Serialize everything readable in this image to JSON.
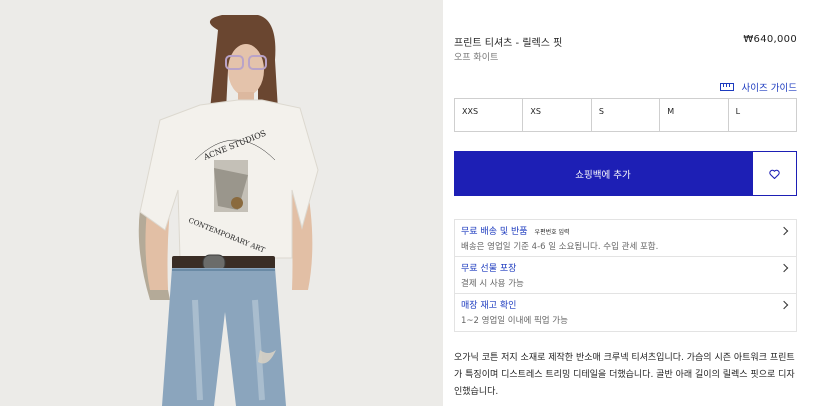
{
  "product": {
    "title": "프린트 티셔츠 - 릴렉스 핏",
    "price": "₩640,000",
    "color": "오프 화이트"
  },
  "size_guide": {
    "label": "사이즈 가이드",
    "icon": "ruler-icon"
  },
  "sizes": [
    "XXS",
    "XS",
    "S",
    "M",
    "L"
  ],
  "cart": {
    "add_label": "쇼핑백에 추가",
    "wishlist_icon": "heart-icon"
  },
  "accordion": [
    {
      "title": "무료 배송 및 반품",
      "tag": "우편번호 입력",
      "subtitle": "배송은 영업일 기준 4-6 일 소요됩니다. 수입 관세 포함."
    },
    {
      "title": "무료 선물 포장",
      "tag": "",
      "subtitle": "결제 시 사용 가능"
    },
    {
      "title": "매장 재고 확인",
      "tag": "",
      "subtitle": "1~2 영업일 이내에 픽업 가능"
    }
  ],
  "description": "오가닉 코튼 저지 소재로 제작한 반소매 크루넥 티셔츠입니다. 가슴의 시즌 아트워크 프린트가 특징이며 디스트레스 트리밍 디테일을 더했습니다. 골반 아래 길이의 릴렉스 핏으로 디자인했습니다.",
  "photo": {
    "print_text_top": "ACNE STUDIOS",
    "print_text_bottom": "CONTEMPORARY ART"
  },
  "colors": {
    "accent": "#1d1fb5",
    "link": "#1d3bbf"
  }
}
